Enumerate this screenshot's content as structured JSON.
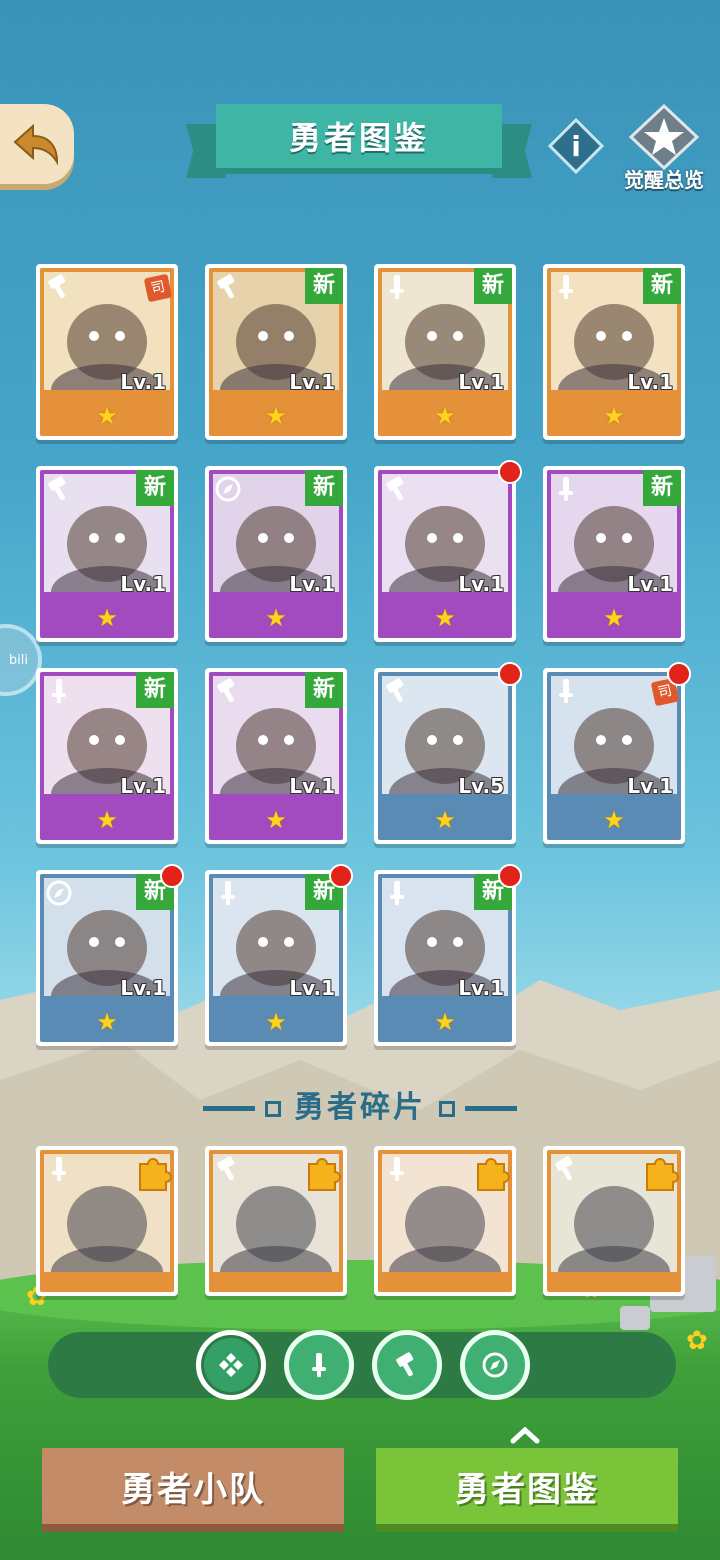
{
  "header": {
    "title": "勇者图鉴",
    "awaken_label": "觉醒总览",
    "info_glyph": "i",
    "side_badge": "bili"
  },
  "heroes": [
    {
      "frame": "orange",
      "class": "hammer-icon",
      "level": "Lv.1",
      "is_new": false,
      "red_dot": false,
      "tag": "司",
      "stars": 1
    },
    {
      "frame": "orange",
      "class": "hammer-icon",
      "level": "Lv.1",
      "is_new": true,
      "red_dot": false,
      "stars": 1
    },
    {
      "frame": "orange",
      "class": "sword-icon",
      "level": "Lv.1",
      "is_new": true,
      "red_dot": false,
      "stars": 1
    },
    {
      "frame": "orange",
      "class": "sword-icon",
      "level": "Lv.1",
      "is_new": true,
      "red_dot": false,
      "stars": 1
    },
    {
      "frame": "purple",
      "class": "hammer-icon",
      "level": "Lv.1",
      "is_new": true,
      "red_dot": false,
      "stars": 1
    },
    {
      "frame": "purple",
      "class": "compass-icon",
      "level": "Lv.1",
      "is_new": true,
      "red_dot": false,
      "stars": 1
    },
    {
      "frame": "purple",
      "class": "hammer-icon",
      "level": "Lv.1",
      "is_new": false,
      "red_dot": true,
      "stars": 1
    },
    {
      "frame": "purple",
      "class": "sword-icon",
      "level": "Lv.1",
      "is_new": true,
      "red_dot": false,
      "stars": 1
    },
    {
      "frame": "purple",
      "class": "sword-icon",
      "level": "Lv.1",
      "is_new": true,
      "red_dot": false,
      "stars": 1
    },
    {
      "frame": "purple",
      "class": "hammer-icon",
      "level": "Lv.1",
      "is_new": true,
      "red_dot": false,
      "stars": 1
    },
    {
      "frame": "blue",
      "class": "hammer-icon",
      "level": "Lv.5",
      "is_new": false,
      "red_dot": true,
      "stars": 1
    },
    {
      "frame": "blue",
      "class": "sword-icon",
      "level": "Lv.1",
      "is_new": false,
      "red_dot": true,
      "tag": "司",
      "stars": 1
    },
    {
      "frame": "blue",
      "class": "compass-icon",
      "level": "Lv.1",
      "is_new": true,
      "red_dot": true,
      "stars": 1
    },
    {
      "frame": "blue",
      "class": "sword-icon",
      "level": "Lv.1",
      "is_new": true,
      "red_dot": true,
      "stars": 1
    },
    {
      "frame": "blue",
      "class": "sword-icon",
      "level": "Lv.1",
      "is_new": true,
      "red_dot": true,
      "stars": 1
    }
  ],
  "new_label": "新",
  "star_glyph": "★",
  "fragments_title": "勇者碎片",
  "fragments": [
    {
      "frame": "orange",
      "class": "sword-icon"
    },
    {
      "frame": "orange",
      "class": "hammer-icon"
    },
    {
      "frame": "orange",
      "class": "sword-icon"
    },
    {
      "frame": "orange",
      "class": "hammer-icon"
    }
  ],
  "filters": [
    {
      "name": "filter-all",
      "icon": "diamond-grid-icon",
      "active": true
    },
    {
      "name": "filter-sword",
      "icon": "sword-icon",
      "active": false
    },
    {
      "name": "filter-hammer",
      "icon": "hammer-icon",
      "active": false
    },
    {
      "name": "filter-compass",
      "icon": "compass-icon",
      "active": false
    }
  ],
  "tabs": {
    "team": "勇者小队",
    "codex": "勇者图鉴"
  },
  "colors": {
    "orange_frame": "#e4913a",
    "purple_frame": "#a24ac0",
    "blue_frame": "#5a8bb5",
    "new_badge": "#34a83a",
    "red_dot": "#e2231a",
    "title_ribbon": "#3fb5a6"
  }
}
